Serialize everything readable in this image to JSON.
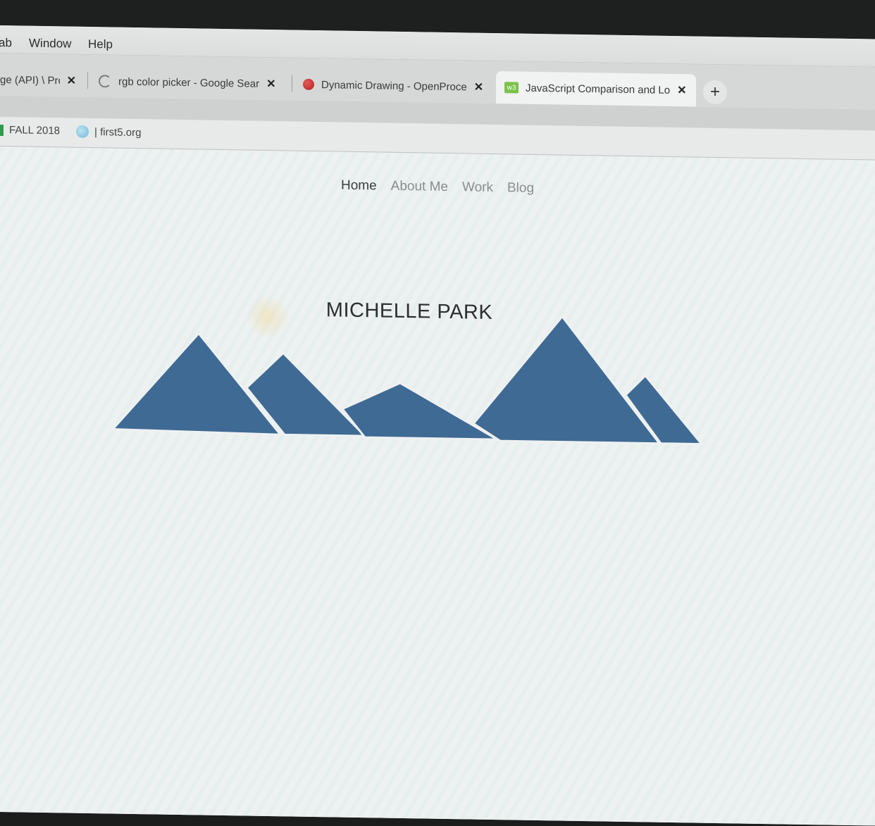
{
  "menubar": {
    "items": [
      "ab",
      "Window",
      "Help"
    ]
  },
  "tabs": [
    {
      "title": "ge (API) \\ Pro",
      "favicon": "processing-icon"
    },
    {
      "title": "rgb color picker - Google Sear",
      "favicon": "google-icon"
    },
    {
      "title": "Dynamic Drawing - OpenProce",
      "favicon": "openprocessing-icon"
    },
    {
      "title": "JavaScript Comparison and Lo",
      "favicon": "w3schools-icon"
    }
  ],
  "bookmarks": [
    {
      "label": "FALL 2018",
      "icon": "sheets-icon"
    },
    {
      "label": "| first5.org",
      "icon": "globe-icon"
    }
  ],
  "site": {
    "nav": [
      "Home",
      "About Me",
      "Work",
      "Blog"
    ],
    "title": "MICHELLE PARK",
    "mountain_color": "#3f6a94"
  }
}
